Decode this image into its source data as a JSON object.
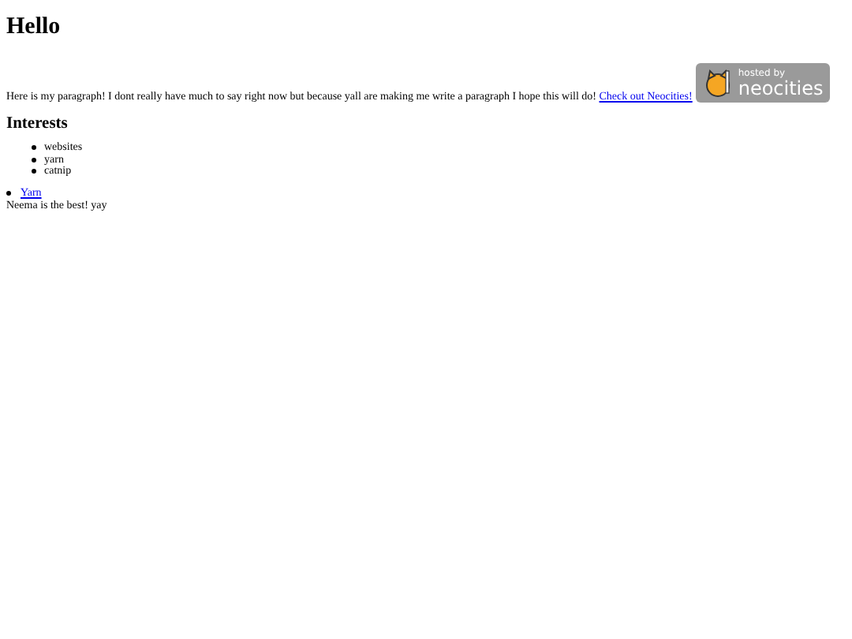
{
  "heading": "Hello",
  "paragraph": {
    "text": "Here is my paragraph! I dont really have much to say right now but because yall are making me write a paragraph I hope this will do!",
    "link": "Check out Neocities!"
  },
  "badge": {
    "line_1": "hosted by",
    "line_2": "neocities"
  },
  "interests": {
    "heading": "Interests",
    "items": [
      "websites",
      "yarn",
      "catnip"
    ]
  },
  "links": [
    "Yarn"
  ],
  "footer": "Neema is the best! yay"
}
